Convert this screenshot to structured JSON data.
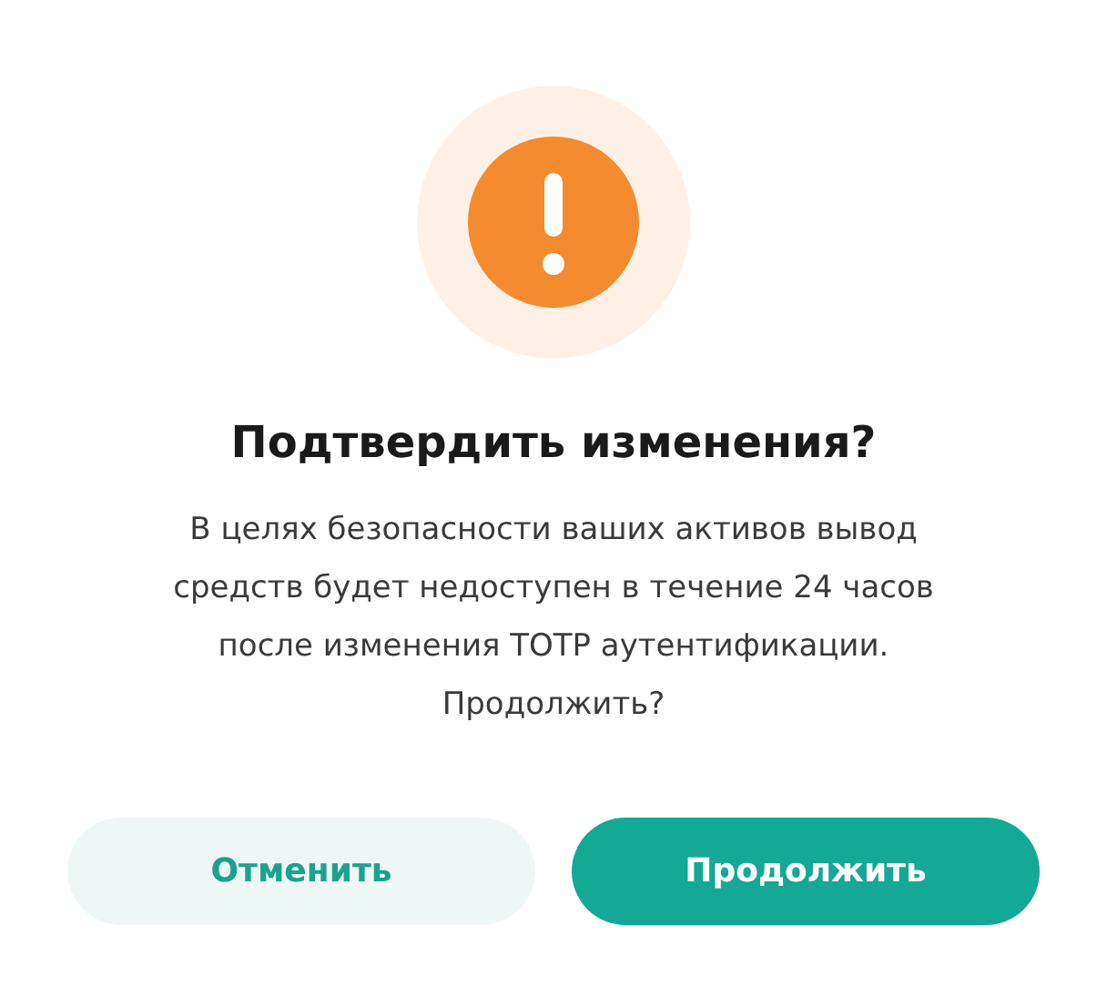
{
  "dialog": {
    "title": "Подтвердить изменения?",
    "message": "В целях безопасности ваших активов вывод средств будет недоступен в течение 24 часов после изменения TOTP аутентификации.",
    "question": "Продолжить?",
    "buttons": [
      {
        "label": "Отменить",
        "kind": "secondary"
      },
      {
        "label": "Продолжить",
        "kind": "primary"
      }
    ]
  }
}
